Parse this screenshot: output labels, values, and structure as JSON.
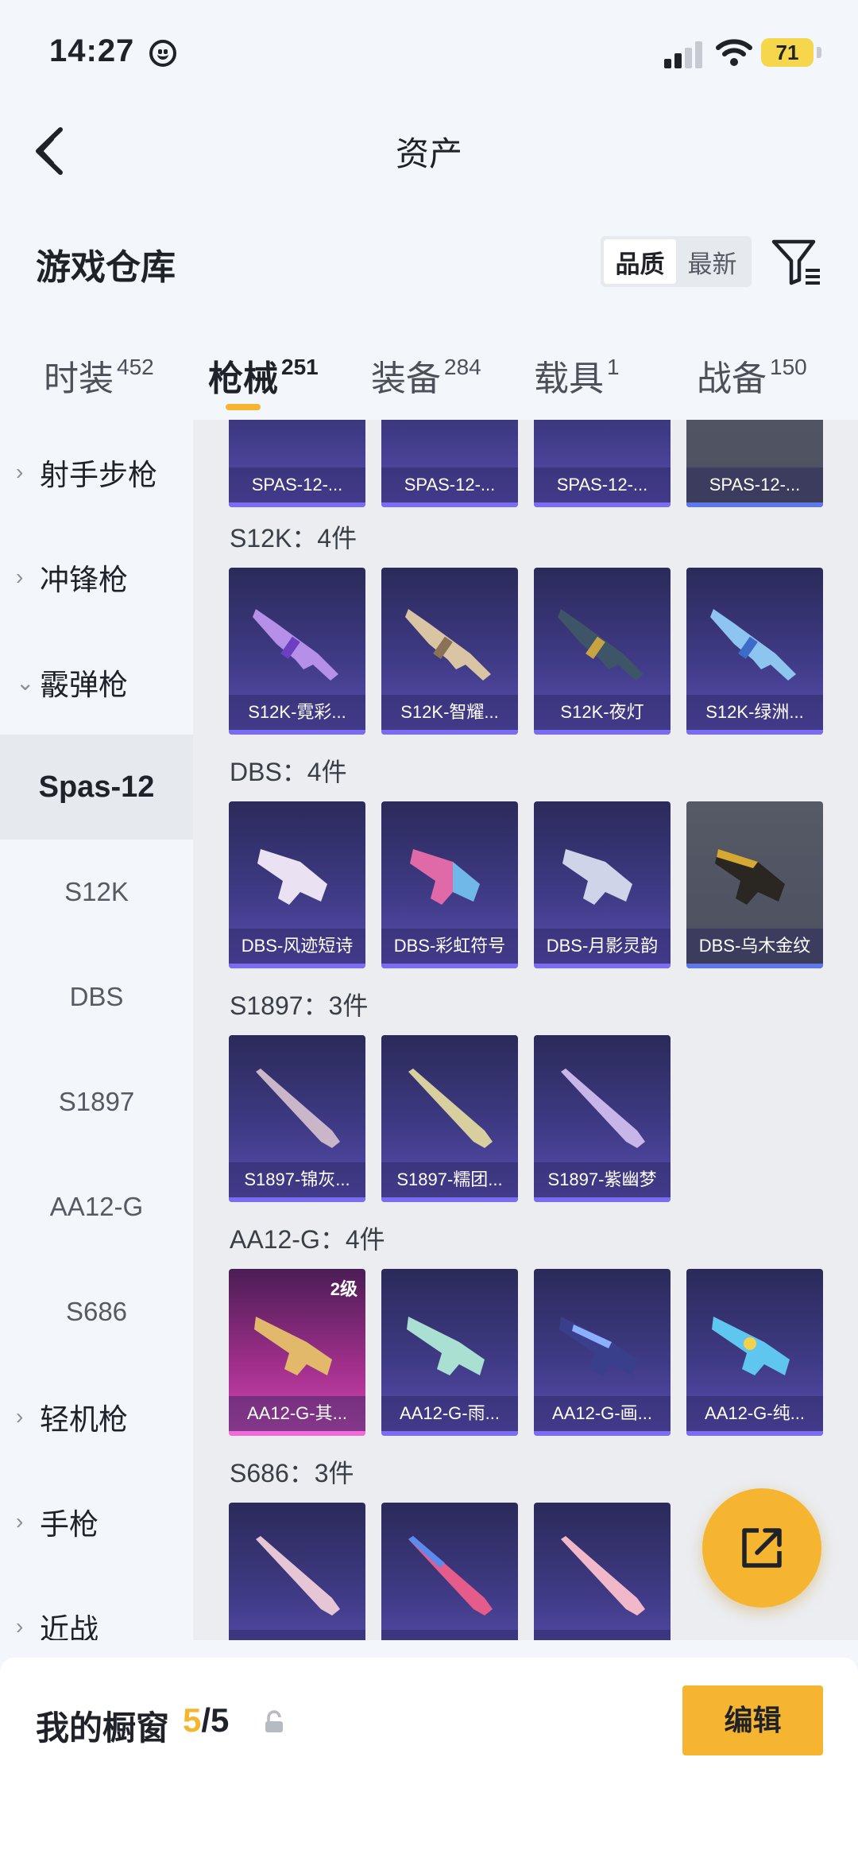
{
  "status_bar": {
    "time": "14:27",
    "battery": "71"
  },
  "nav": {
    "title": "资产"
  },
  "section": {
    "title": "游戏仓库",
    "sort_quality": "品质",
    "sort_newest": "最新"
  },
  "tabs": [
    {
      "label": "时装",
      "count": "452"
    },
    {
      "label": "枪械",
      "count": "251"
    },
    {
      "label": "装备",
      "count": "284"
    },
    {
      "label": "载具",
      "count": "1"
    },
    {
      "label": "战备",
      "count": "150"
    }
  ],
  "sidebar": {
    "categories": [
      {
        "label": "射手步枪"
      },
      {
        "label": "冲锋枪"
      },
      {
        "label": "霰弹枪"
      },
      {
        "label": "轻机枪"
      },
      {
        "label": "手枪"
      },
      {
        "label": "近战"
      }
    ],
    "sub_items": [
      {
        "label": "Spas-12"
      },
      {
        "label": "S12K"
      },
      {
        "label": "DBS"
      },
      {
        "label": "S1897"
      },
      {
        "label": "AA12-G"
      },
      {
        "label": "S686"
      }
    ]
  },
  "groups": [
    {
      "title": "",
      "items": [
        "SPAS-12-...",
        "SPAS-12-...",
        "SPAS-12-...",
        "SPAS-12-..."
      ]
    },
    {
      "title": "S12K：4件",
      "items": [
        "S12K-霓彩...",
        "S12K-智耀...",
        "S12K-夜灯",
        "S12K-绿洲..."
      ]
    },
    {
      "title": "DBS：4件",
      "items": [
        "DBS-风迹短诗",
        "DBS-彩虹符号",
        "DBS-月影灵韵",
        "DBS-乌木金纹"
      ]
    },
    {
      "title": "S1897：3件",
      "items": [
        "S1897-锦灰...",
        "S1897-糯团...",
        "S1897-紫幽梦"
      ]
    },
    {
      "title": "AA12-G：4件",
      "items": [
        "AA12-G-其...",
        "AA12-G-雨...",
        "AA12-G-画...",
        "AA12-G-纯..."
      ],
      "level_badge": "2级"
    },
    {
      "title": "S686：3件",
      "items": [
        "",
        "",
        ""
      ]
    }
  ],
  "bottom": {
    "label": "我的橱窗",
    "current": "5",
    "total": "/5",
    "edit_button": "编辑"
  },
  "colors": {
    "accent": "#f5b531",
    "card_purple": "#3f3a85",
    "card_grey": "#565a66",
    "card_pink": "#a3308d"
  },
  "icons": [
    "back-icon",
    "filter-icon",
    "chevron-right-icon",
    "chevron-down-icon",
    "share-icon",
    "lock-icon"
  ]
}
